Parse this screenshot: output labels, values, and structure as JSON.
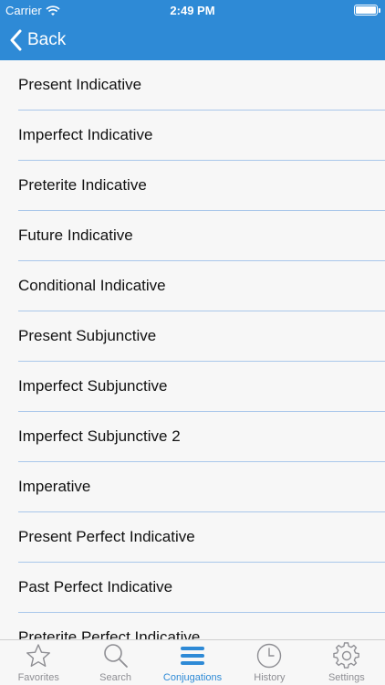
{
  "status": {
    "carrier": "Carrier",
    "time": "2:49 PM"
  },
  "nav": {
    "back_label": "Back"
  },
  "list": {
    "items": [
      "Present Indicative",
      "Imperfect Indicative",
      "Preterite Indicative",
      "Future Indicative",
      "Conditional Indicative",
      "Present Subjunctive",
      "Imperfect Subjunctive",
      "Imperfect Subjunctive 2",
      "Imperative",
      "Present Perfect Indicative",
      "Past Perfect Indicative",
      "Preterite Perfect Indicative"
    ]
  },
  "tabbar": {
    "tabs": [
      {
        "label": "Favorites",
        "icon": "star-icon"
      },
      {
        "label": "Search",
        "icon": "search-icon"
      },
      {
        "label": "Conjugations",
        "icon": "menu-icon"
      },
      {
        "label": "History",
        "icon": "clock-icon"
      },
      {
        "label": "Settings",
        "icon": "gear-icon"
      }
    ],
    "active_index": 2
  },
  "colors": {
    "accent": "#2e8ad6",
    "divider": "#a9c7ea",
    "inactive": "#8e8e93"
  }
}
